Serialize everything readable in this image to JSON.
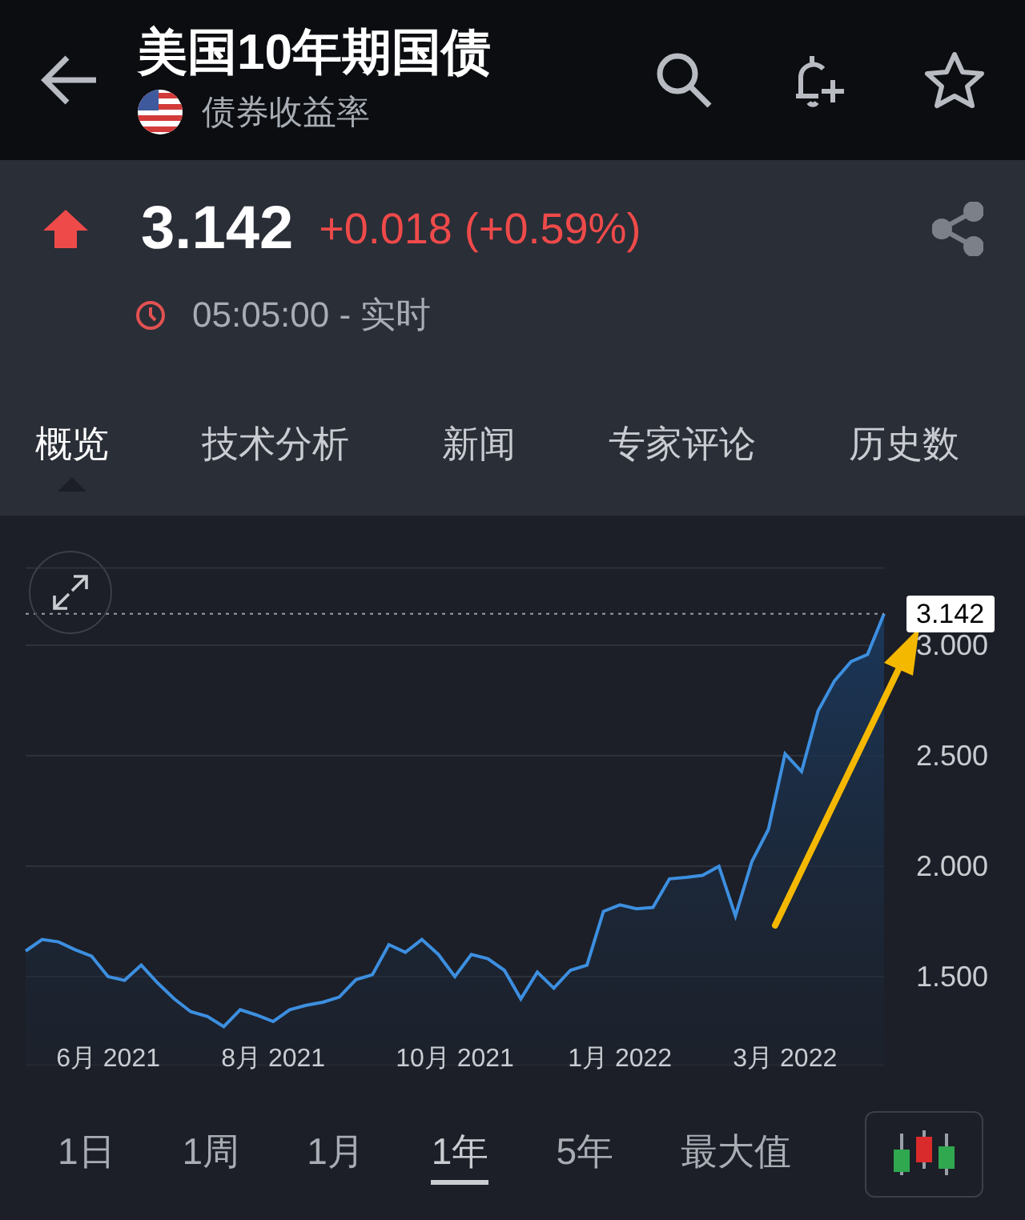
{
  "header": {
    "title": "美国10年期国债",
    "subtitle": "债券收益率"
  },
  "quote": {
    "rising": true,
    "price": "3.142",
    "change": "+0.018 (+0.59%)",
    "time": "05:05:00 - 实时"
  },
  "tabs": [
    {
      "label": "概览",
      "selected": true
    },
    {
      "label": "技术分析",
      "selected": false
    },
    {
      "label": "新闻",
      "selected": false
    },
    {
      "label": "专家评论",
      "selected": false
    },
    {
      "label": "历史数",
      "selected": false
    }
  ],
  "chart": {
    "arrow": {
      "color": "#f5b800"
    },
    "chart_data": {
      "type": "area",
      "grid": true,
      "categories": [
        null,
        null,
        null,
        null,
        null,
        "6月 2021",
        null,
        null,
        null,
        null,
        null,
        null,
        null,
        null,
        null,
        "8月 2021",
        null,
        null,
        null,
        null,
        null,
        null,
        null,
        null,
        null,
        null,
        "10月 2021",
        null,
        null,
        null,
        null,
        null,
        null,
        null,
        null,
        null,
        "1月 2022",
        null,
        null,
        null,
        null,
        null,
        null,
        null,
        null,
        null,
        "3月 2022",
        null,
        null,
        null,
        null,
        null,
        null
      ],
      "ylim": [
        1.1,
        3.35
      ],
      "values": [
        1.616,
        1.668,
        1.657,
        1.622,
        1.593,
        1.5,
        1.483,
        1.552,
        1.471,
        1.399,
        1.341,
        1.32,
        1.274,
        1.35,
        1.326,
        1.297,
        1.35,
        1.37,
        1.384,
        1.407,
        1.486,
        1.509,
        1.645,
        1.61,
        1.668,
        1.601,
        1.5,
        1.601,
        1.581,
        1.529,
        1.399,
        1.52,
        1.448,
        1.529,
        1.552,
        1.796,
        1.825,
        1.807,
        1.813,
        1.943,
        1.949,
        1.958,
        1.999,
        1.775,
        2.022,
        2.167,
        2.509,
        2.428,
        2.703,
        2.839,
        2.926,
        2.958,
        3.142
      ],
      "yticks": [
        {
          "value": 1.5,
          "label": "1.500"
        },
        {
          "value": 2,
          "label": "2.000"
        },
        {
          "value": 2.5,
          "label": "2.500"
        },
        {
          "value": 3,
          "label": "3.000"
        }
      ],
      "ref_lines": [
        {
          "axis": "y",
          "value": 3.142,
          "label": "3.142"
        }
      ]
    }
  },
  "ranges": [
    {
      "label": "1日",
      "selected": false
    },
    {
      "label": "1周",
      "selected": false
    },
    {
      "label": "1月",
      "selected": false
    },
    {
      "label": "1年",
      "selected": true
    },
    {
      "label": "5年",
      "selected": false
    },
    {
      "label": "最大值",
      "selected": false
    }
  ]
}
